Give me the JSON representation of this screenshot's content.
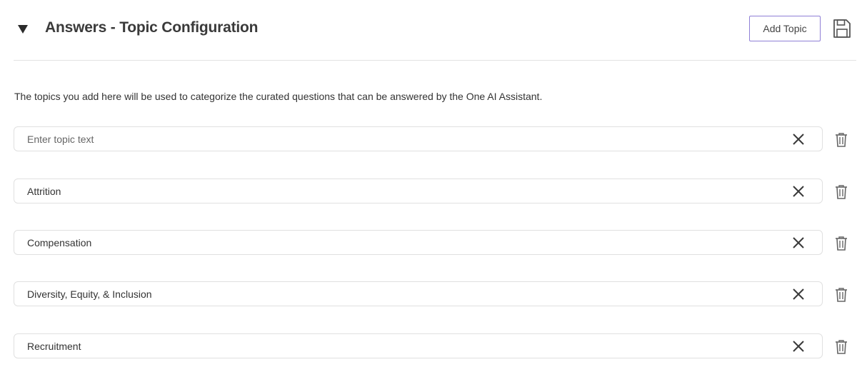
{
  "header": {
    "title": "Answers - Topic Configuration",
    "add_topic_label": "Add Topic",
    "collapse_icon": "triangle-down-icon",
    "save_icon": "floppy-disk-icon"
  },
  "description": "The topics you add here will be used to categorize the curated questions that can be answered by the One AI Assistant.",
  "topics": [
    {
      "value": "",
      "placeholder": "Enter topic text"
    },
    {
      "value": "Attrition",
      "placeholder": "Enter topic text"
    },
    {
      "value": "Compensation",
      "placeholder": "Enter topic text"
    },
    {
      "value": "Diversity, Equity, & Inclusion",
      "placeholder": "Enter topic text"
    },
    {
      "value": "Recruitment",
      "placeholder": "Enter topic text"
    }
  ],
  "icons": {
    "clear": "close-icon",
    "delete": "trash-icon"
  },
  "colors": {
    "accent_border": "#8f7fd6",
    "field_border": "#e0e0e0",
    "icon": "#555555"
  }
}
